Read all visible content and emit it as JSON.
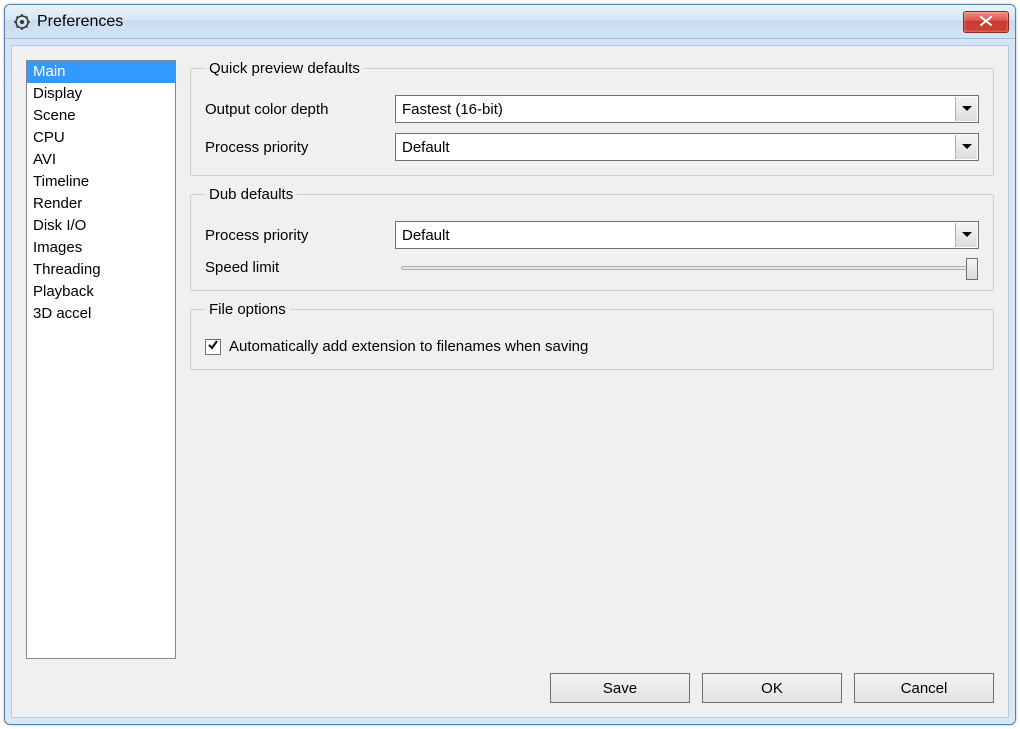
{
  "window": {
    "title": "Preferences"
  },
  "sidebar": {
    "items": [
      {
        "label": "Main",
        "selected": true
      },
      {
        "label": "Display",
        "selected": false
      },
      {
        "label": "Scene",
        "selected": false
      },
      {
        "label": "CPU",
        "selected": false
      },
      {
        "label": "AVI",
        "selected": false
      },
      {
        "label": "Timeline",
        "selected": false
      },
      {
        "label": "Render",
        "selected": false
      },
      {
        "label": "Disk I/O",
        "selected": false
      },
      {
        "label": "Images",
        "selected": false
      },
      {
        "label": "Threading",
        "selected": false
      },
      {
        "label": "Playback",
        "selected": false
      },
      {
        "label": "3D accel",
        "selected": false
      }
    ]
  },
  "quick_preview": {
    "legend": "Quick preview defaults",
    "color_depth_label": "Output color depth",
    "color_depth_value": "Fastest (16-bit)",
    "priority_label": "Process priority",
    "priority_value": "Default"
  },
  "dub": {
    "legend": "Dub defaults",
    "priority_label": "Process priority",
    "priority_value": "Default",
    "speed_label": "Speed limit"
  },
  "file_options": {
    "legend": "File options",
    "auto_ext_checked": true,
    "auto_ext_label": "Automatically add extension to filenames when saving"
  },
  "buttons": {
    "save": "Save",
    "ok": "OK",
    "cancel": "Cancel"
  }
}
